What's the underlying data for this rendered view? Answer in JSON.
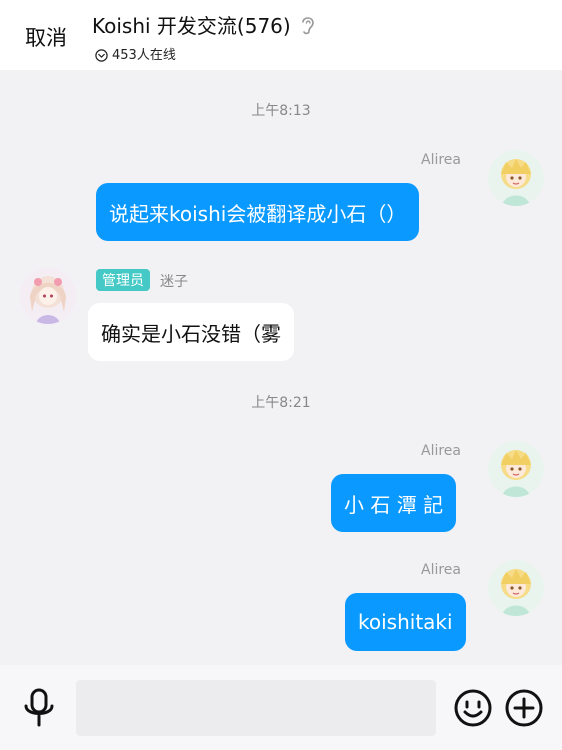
{
  "header": {
    "cancel_label": "取消",
    "title": "Koishi 开发交流(576)",
    "online_text": "453人在线"
  },
  "messages": [
    {
      "type": "time",
      "text": "上午8:13"
    },
    {
      "type": "outgoing",
      "sender": "Alirea",
      "text": "说起来koishi会被翻译成小石（）"
    },
    {
      "type": "incoming",
      "badge": "管理员",
      "sender": "迷子",
      "text": "确实是小石没错（雾"
    },
    {
      "type": "time",
      "text": "上午8:21"
    },
    {
      "type": "outgoing",
      "sender": "Alirea",
      "text": "小 石 潭 記"
    },
    {
      "type": "outgoing",
      "sender": "Alirea",
      "text": "koishitaki"
    }
  ],
  "input": {
    "placeholder": ""
  },
  "icons": {
    "ear": "ear-icon",
    "online": "chevron-circle-icon",
    "mic": "microphone-icon",
    "emoji": "emoji-icon",
    "plus": "plus-icon"
  },
  "colors": {
    "outgoing_bubble": "#0a99ff",
    "admin_badge": "#45c9c6",
    "background": "#f2f2f5"
  }
}
